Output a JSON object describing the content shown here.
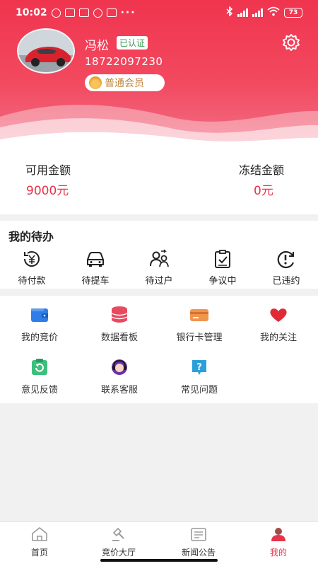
{
  "status_bar": {
    "time": "10:02",
    "dots": "···",
    "battery": "73"
  },
  "profile": {
    "name": "冯松",
    "verified_badge": "已认证",
    "phone": "18722097230",
    "member_level": "普通会员"
  },
  "balance": {
    "available_label": "可用金额",
    "available_value": "9000元",
    "frozen_label": "冻结金额",
    "frozen_value": "0元"
  },
  "todo": {
    "title": "我的待办",
    "items": [
      {
        "label": "待付款",
        "icon": "yen-clock-icon"
      },
      {
        "label": "待提车",
        "icon": "car-icon"
      },
      {
        "label": "待过户",
        "icon": "transfer-users-icon"
      },
      {
        "label": "争议中",
        "icon": "clipboard-check-icon"
      },
      {
        "label": "已违约",
        "icon": "exclamation-cycle-icon"
      }
    ]
  },
  "services": [
    {
      "label": "我的竞价",
      "icon": "wallet-icon"
    },
    {
      "label": "数据看板",
      "icon": "database-icon"
    },
    {
      "label": "银行卡管理",
      "icon": "bank-card-icon"
    },
    {
      "label": "我的关注",
      "icon": "heart-icon"
    },
    {
      "label": "意见反馈",
      "icon": "feedback-icon"
    },
    {
      "label": "联系客服",
      "icon": "customer-service-icon"
    },
    {
      "label": "常见问题",
      "icon": "question-icon"
    }
  ],
  "tabs": [
    {
      "label": "首页",
      "icon": "home-icon"
    },
    {
      "label": "竞价大厅",
      "icon": "gavel-icon"
    },
    {
      "label": "新闻公告",
      "icon": "news-icon"
    },
    {
      "label": "我的",
      "icon": "user-icon"
    }
  ],
  "colors": {
    "brand": "#f0344e",
    "accent_text": "#e8344b",
    "verified": "#3a9a53"
  }
}
